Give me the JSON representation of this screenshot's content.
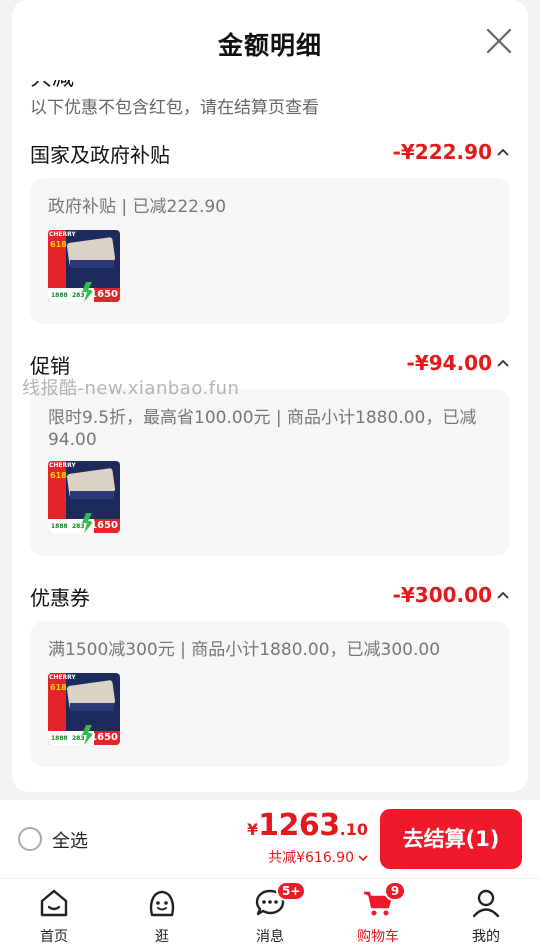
{
  "panel": {
    "title": "金额明细",
    "cut_label": "共减",
    "cut_amount": "-¥616.90",
    "note": "以下优惠不包含红包，请在结算页查看"
  },
  "sections": [
    {
      "title": "国家及政府补贴",
      "amount": "-¥222.90",
      "desc": "政府补贴 | 已减222.90"
    },
    {
      "title": "促销",
      "amount": "-¥94.00",
      "desc": "限时9.5折，最高省100.00元 | 商品小计1880.00，已减94.00"
    },
    {
      "title": "优惠券",
      "amount": "-¥300.00",
      "desc": "满1500减300元 | 商品小计1880.00，已减300.00"
    }
  ],
  "product_thumb": {
    "brand": "CHERRY",
    "tag": "618",
    "price_badge": "1650",
    "left_figure": "1888",
    "mid_figure": "283"
  },
  "watermark": "线报酷-new.xianbao.fun",
  "checkout": {
    "select_all": "全选",
    "yen": "¥",
    "total_int": "1263",
    "total_dec": ".10",
    "saved": "共减¥616.90",
    "button": "去结算(1)"
  },
  "tabs": [
    {
      "label": "首页",
      "icon": "home-icon",
      "badge": ""
    },
    {
      "label": "逛",
      "icon": "stroll-icon",
      "badge": ""
    },
    {
      "label": "消息",
      "icon": "message-icon",
      "badge": "5+"
    },
    {
      "label": "购物车",
      "icon": "cart-icon",
      "badge": "9"
    },
    {
      "label": "我的",
      "icon": "profile-icon",
      "badge": ""
    }
  ],
  "colors": {
    "accent": "#f0192a",
    "price": "#e4191c",
    "card_bg": "#f6f6f6"
  }
}
